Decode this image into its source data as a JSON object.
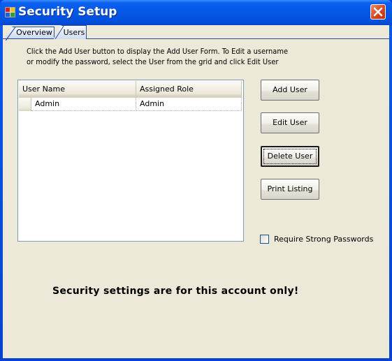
{
  "window": {
    "title": "Security Setup",
    "icon": "app-window-icon",
    "close_icon": "close-icon"
  },
  "tabs": [
    {
      "label": "Overview",
      "active": false
    },
    {
      "label": "Users",
      "active": true
    }
  ],
  "users_tab": {
    "instructions_line1": "Click the Add User button to display the Add User Form.  To Edit a username",
    "instructions_line2": "or modify the password, select the User from the grid and click Edit User",
    "grid": {
      "columns": [
        "User Name",
        "Assigned Role"
      ],
      "rows": [
        {
          "user_name": "Admin",
          "assigned_role": "Admin"
        }
      ]
    },
    "buttons": {
      "add_user": "Add User",
      "edit_user": "Edit User",
      "delete_user": "Delete User",
      "print_listing": "Print Listing"
    },
    "require_strong_passwords": {
      "label": "Require Strong Passwords",
      "checked": false
    },
    "notice": "Security settings are for this account only!"
  }
}
